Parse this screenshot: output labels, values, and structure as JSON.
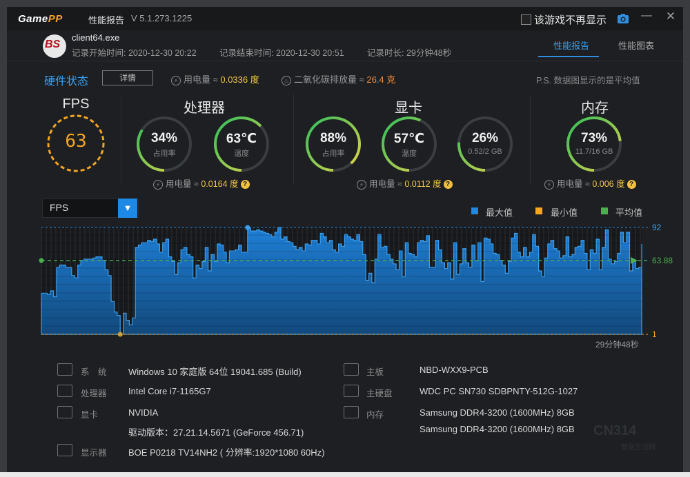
{
  "app": {
    "logo_a": "Game",
    "logo_b": "PP",
    "title": "性能报告",
    "version": "V 5.1.273.1225",
    "hide_game_label": "该游戏不再显示",
    "minimize_glyph": "—",
    "close_glyph": "✕"
  },
  "session": {
    "exe": "client64.exe",
    "app_icon_text": "BS",
    "start_label": "记录开始时间: 2020-12-30 20:22",
    "end_label": "记录结束时间: 2020-12-30 20:51",
    "duration_label": "记录时长: 29分钟48秒"
  },
  "tabs": [
    {
      "label": "性能报告",
      "active": true
    },
    {
      "label": "性能图表",
      "active": false
    }
  ],
  "hardware": {
    "title": "硬件状态",
    "detail_button": "详情",
    "power_label": "用电量 ≈ ",
    "power_value": "0.0336 度",
    "carbon_label": "二氧化碳排放量 ≈ ",
    "carbon_value": "26.4 克",
    "note": "P.S. 数据图显示的是平均值"
  },
  "sections": {
    "fps": {
      "title": "FPS",
      "value": "63"
    },
    "cpu": {
      "title": "处理器",
      "usage": {
        "value": "34%",
        "sub": "占用率",
        "fraction": 0.34
      },
      "temp": {
        "value": "63℃",
        "sub": "温度",
        "fraction": 0.63
      },
      "power_label": "用电量 ≈ ",
      "power_value": "0.0164 度"
    },
    "gpu": {
      "title": "显卡",
      "usage": {
        "value": "88%",
        "sub": "占用率",
        "fraction": 0.88
      },
      "temp": {
        "value": "57℃",
        "sub": "温度",
        "fraction": 0.57
      },
      "mem": {
        "value": "26%",
        "sub": "0.52/2 GB",
        "fraction": 0.26
      },
      "power_label": "用电量 ≈ ",
      "power_value": "0.0112 度"
    },
    "mem": {
      "title": "内存",
      "usage": {
        "value": "73%",
        "sub": "11.7/16 GB",
        "fraction": 0.73
      },
      "power_label": "用电量 ≈ ",
      "power_value": "0.006 度"
    }
  },
  "chart": {
    "selector": "FPS",
    "legend": [
      {
        "label": "最大值",
        "color": "#1e88e5"
      },
      {
        "label": "最小值",
        "color": "#f5a623"
      },
      {
        "label": "平均值",
        "color": "#4caf50"
      }
    ],
    "max_label": "92",
    "avg_label": "63.88",
    "min_label": "1",
    "duration": "29分钟48秒"
  },
  "chart_data": {
    "type": "area",
    "title": "FPS",
    "ylim": [
      1,
      92
    ],
    "max": 92,
    "min": 1,
    "avg": 63.88,
    "values": [
      36,
      36,
      35,
      38,
      33,
      58,
      60,
      60,
      58,
      58,
      51,
      49,
      60,
      64,
      65,
      65,
      65,
      66,
      67,
      67,
      64,
      56,
      51,
      29,
      20,
      17,
      1,
      19,
      13,
      9,
      15,
      75,
      77,
      79,
      79,
      81,
      80,
      82,
      78,
      71,
      79,
      82,
      67,
      63,
      52,
      62,
      73,
      75,
      69,
      67,
      49,
      60,
      57,
      63,
      75,
      55,
      69,
      63,
      78,
      77,
      71,
      62,
      72,
      72,
      73,
      77,
      71,
      71,
      92,
      89,
      89,
      90,
      89,
      88,
      87,
      86,
      84,
      88,
      92,
      82,
      84,
      80,
      79,
      76,
      73,
      75,
      72,
      78,
      77,
      81,
      81,
      78,
      87,
      84,
      79,
      81,
      73,
      71,
      78,
      76,
      86,
      84,
      82,
      81,
      86,
      80,
      69,
      47,
      53,
      45,
      65,
      86,
      75,
      76,
      69,
      65,
      61,
      56,
      72,
      50,
      79,
      70,
      69,
      67,
      79,
      81,
      80,
      85,
      58,
      58,
      81,
      73,
      62,
      57,
      62,
      48,
      79,
      52,
      61,
      74,
      62,
      58,
      77,
      64,
      79,
      46,
      83,
      82,
      78,
      70,
      69,
      64,
      60,
      53,
      63,
      83,
      87,
      71,
      67,
      75,
      67,
      71,
      86,
      76,
      55,
      50,
      66,
      78,
      81,
      74,
      72,
      66,
      68,
      84,
      67,
      69,
      75,
      76,
      81,
      70,
      56,
      73,
      70,
      82,
      56,
      75,
      90,
      65,
      61,
      63,
      70,
      88,
      79,
      88,
      55,
      64,
      57,
      58,
      78
    ]
  },
  "system_info": {
    "left": [
      {
        "icon": "windows-icon",
        "label": "系　统",
        "value": "Windows 10 家庭版 64位   19041.685 (Build)"
      },
      {
        "icon": "cpu-icon",
        "label": "处理器",
        "value": "Intel Core i7-1165G7"
      },
      {
        "icon": "gpu-icon",
        "label": "显卡",
        "value": "NVIDIA"
      },
      {
        "icon": "",
        "label": "",
        "value": "驱动版本：27.21.14.5671 (GeForce 456.71)"
      },
      {
        "icon": "monitor-icon",
        "label": "显示器",
        "value": "BOE P0218 TV14NH2 ( 分辨率:1920*1080 60Hz)"
      }
    ],
    "right": [
      {
        "icon": "motherboard-icon",
        "label": "主板",
        "value": "NBD-WXX9-PCB"
      },
      {
        "icon": "harddisk-icon",
        "label": "主硬盘",
        "value": "WDC PC SN730 SDBPNTY-512G-1027"
      },
      {
        "icon": "memory-icon",
        "label": "内存",
        "value": "Samsung DDR4-3200 (1600MHz) 8GB"
      },
      {
        "icon": "",
        "label": "",
        "value": "Samsung DDR4-3200 (1600MHz) 8GB"
      }
    ]
  },
  "watermark": {
    "line1": "CN314",
    "line2": "智能生活网"
  },
  "colors": {
    "accent": "#2e8fe0",
    "fps_ring": "#f5a623",
    "gauge_track": "#3a3d42"
  }
}
